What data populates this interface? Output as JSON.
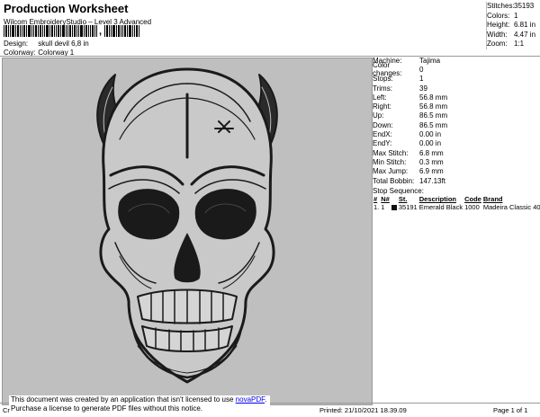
{
  "header": {
    "title": "Production Worksheet",
    "subtitle": "Wilcom EmbroideryStudio – Level 3 Advanced"
  },
  "meta": {
    "design_label": "Design:",
    "design_value": "skull devil 6,8 in",
    "colorway_label": "Colorway:",
    "colorway_value": "Colorway 1"
  },
  "summary": [
    {
      "k": "Stitches:",
      "v": "35193"
    },
    {
      "k": "Colors:",
      "v": "1"
    },
    {
      "k": "Height:",
      "v": "6.81 in"
    },
    {
      "k": "Width:",
      "v": "4.47 in"
    },
    {
      "k": "Zoom:",
      "v": "1:1"
    }
  ],
  "properties": [
    {
      "k": "Machine:",
      "v": "Tajima"
    },
    {
      "k": "Color changes:",
      "v": "0"
    },
    {
      "k": "Stops:",
      "v": "1"
    },
    {
      "k": "Trims:",
      "v": "39"
    },
    {
      "k": "Left:",
      "v": "56.8 mm"
    },
    {
      "k": "Right:",
      "v": "56.8 mm"
    },
    {
      "k": "Up:",
      "v": "86.5 mm"
    },
    {
      "k": "Down:",
      "v": "86.5 mm"
    },
    {
      "k": "EndX:",
      "v": "0.00 in"
    },
    {
      "k": "EndY:",
      "v": "0.00 in"
    },
    {
      "k": "Max Stitch:",
      "v": "6.8 mm"
    },
    {
      "k": "Min Stitch:",
      "v": "0.3 mm"
    },
    {
      "k": "Max Jump:",
      "v": "6.9 mm"
    },
    {
      "k": "Total Bobbin:",
      "v": "147.13ft"
    }
  ],
  "stop_sequence": {
    "label": "Stop Sequence:",
    "columns": [
      "#",
      "N#",
      "",
      "St.",
      "Description",
      "Code",
      "Brand"
    ],
    "rows": [
      {
        "num": "1.",
        "n": "1",
        "st": "35191",
        "desc": "Emerald Black",
        "code": "1000",
        "brand": "Madeira Classic 40",
        "color": "#111111"
      }
    ]
  },
  "notice": {
    "line1_pre": "This document was created by an application that isn't licensed to use ",
    "link": "novaPDF",
    "line1_post": ".",
    "line2": "Purchase a license to generate PDF files without this notice."
  },
  "footer": {
    "left": "Cr",
    "printed": "Printed: 21/10/2021 18.39.09",
    "page": "Page 1 of 1"
  },
  "colors": {
    "design_bg": "#bfbfbf",
    "thread": "#1a1a1a"
  }
}
